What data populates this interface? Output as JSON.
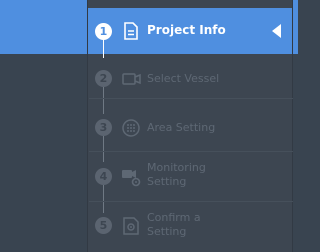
{
  "colors": {
    "accent": "#4f8fe0",
    "panel": "#3d4651",
    "inactive_text": "#5e6874"
  },
  "steps": [
    {
      "number": "1",
      "label": "Project Info",
      "icon": "document-icon",
      "state": "active"
    },
    {
      "number": "2",
      "label": "Select Vessel",
      "icon": "video-camera-icon",
      "state": "inactive"
    },
    {
      "number": "3",
      "label": "Area Setting",
      "icon": "grid-dots-icon",
      "state": "inactive"
    },
    {
      "number": "4",
      "label_line1": "Monitoring",
      "label_line2": "Setting",
      "icon": "camera-gear-icon",
      "state": "inactive"
    },
    {
      "number": "5",
      "label_line1": "Confirm a",
      "label_line2": "Setting",
      "icon": "confirm-settings-icon",
      "state": "inactive"
    }
  ]
}
